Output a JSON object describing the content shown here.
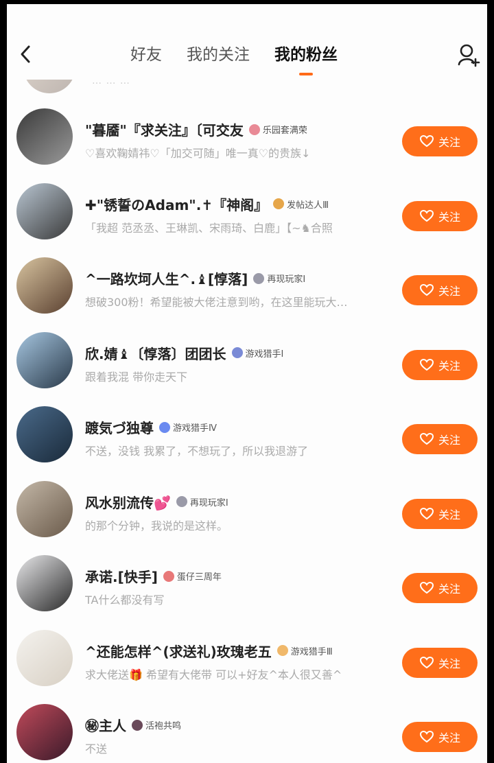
{
  "header": {
    "tabs": [
      {
        "label": "好友"
      },
      {
        "label": "我的关注"
      },
      {
        "label": "我的粉丝"
      }
    ],
    "active_tab": 2
  },
  "peek_row": {
    "text": "… … …"
  },
  "follow_label": "关注",
  "fans": [
    {
      "name": "\"暮靥\"『求关注』〔可交友",
      "badge": "乐园套满荣",
      "badge_color": "#e98a96",
      "signature": "♡喜欢鞠婧祎♡「加交可随」唯一真♡的贵族↓",
      "avatar_colors": [
        "#3a3a3a",
        "#9a9a9a"
      ]
    },
    {
      "name": "✚\"锈誓のAdam\".✝『神阁』",
      "badge": "发帖达人Ⅲ",
      "badge_color": "#e6a64a",
      "signature": "「我超 范丞丞、王琳凯、宋雨琦、白鹿」【~♞合照",
      "avatar_colors": [
        "#b9c6d2",
        "#3a3a3a"
      ]
    },
    {
      "name": "^一路坎坷人生^.♝[惇落]",
      "badge": "再现玩家Ⅰ",
      "badge_color": "#9a9aa8",
      "signature": "想破300粉！希望能被大佬注意到哟，在这里能玩大…",
      "avatar_colors": [
        "#d8c4a0",
        "#5a4030"
      ]
    },
    {
      "name": "欣.婧♝〔惇落〕团团长",
      "badge": "游戏猎手Ⅰ",
      "badge_color": "#7a8ad6",
      "signature": "跟着我混 带你走天下",
      "avatar_colors": [
        "#a6c6e0",
        "#2a3a4a"
      ]
    },
    {
      "name": "踱気づ独尊",
      "badge": "游戏猎手Ⅳ",
      "badge_color": "#6a8af0",
      "signature": "不送，没钱 我累了，不想玩了，所以我退游了",
      "avatar_colors": [
        "#4a6a8a",
        "#1a2a3a"
      ]
    },
    {
      "name": "风水别流传💕",
      "badge": "再现玩家Ⅰ",
      "badge_color": "#9a9aa8",
      "signature": "的那个分钟，我说的是这样。",
      "avatar_colors": [
        "#c4b8a8",
        "#6a5a4a"
      ]
    },
    {
      "name": "承诺.[快手]",
      "badge": "蛋仔三周年",
      "badge_color": "#e87878",
      "signature": "TA什么都没有写",
      "avatar_colors": [
        "#e8e8ea",
        "#2a2a2a"
      ]
    },
    {
      "name": "^还能怎样^(求送礼)玫瑰老五",
      "badge": "游戏猎手Ⅲ",
      "badge_color": "#f0b86a",
      "signature": "求大佬送🎁 希望有大佬带 可以+好友^本人很又善^",
      "avatar_colors": [
        "#f4f2ee",
        "#d8d0c4"
      ]
    },
    {
      "name": "㊙主人",
      "badge": "活袍共鸣",
      "badge_color": "#6a4a5a",
      "signature": "不送",
      "avatar_colors": [
        "#c04a5a",
        "#3a1a2a"
      ]
    }
  ]
}
